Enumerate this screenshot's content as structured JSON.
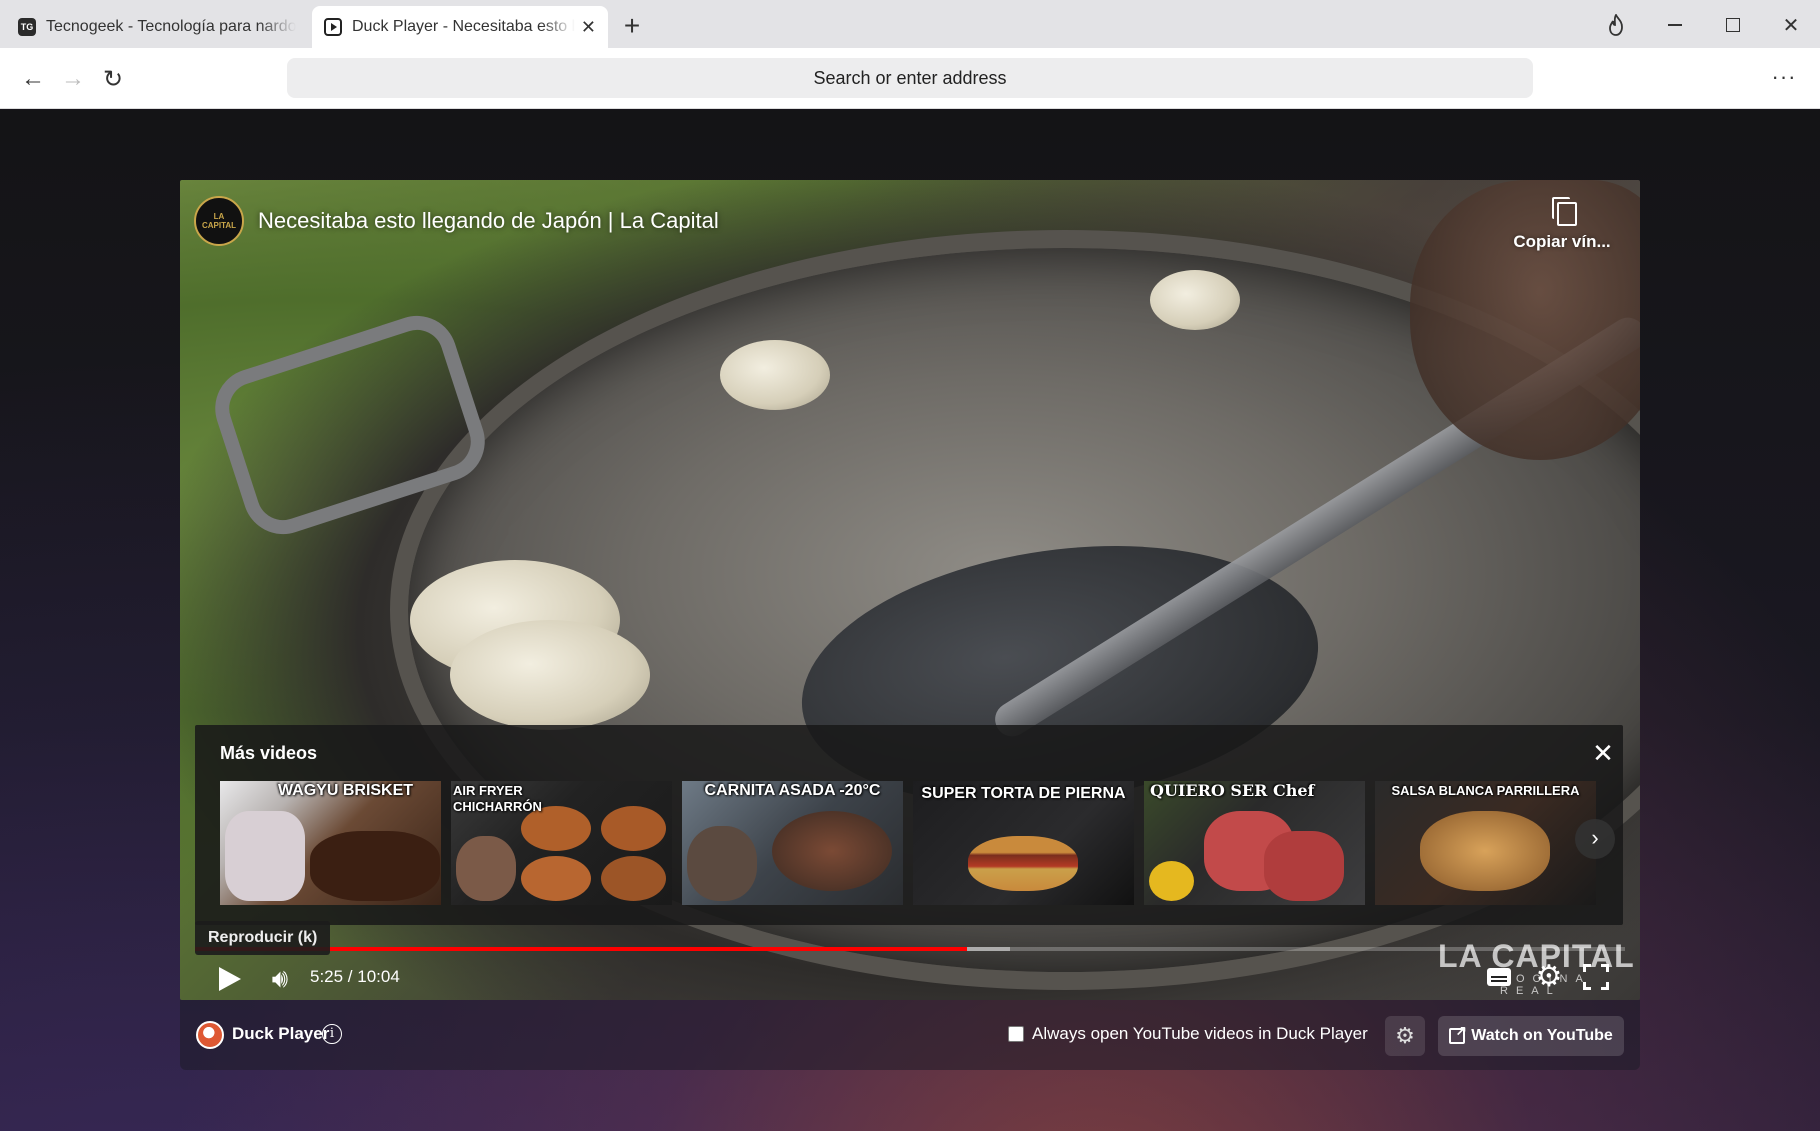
{
  "browser": {
    "tabs": [
      {
        "title": "Tecnogeek - Tecnología para nardogeeks",
        "favicon": "TG",
        "active": false
      },
      {
        "title": "Duck Player - Necesitaba esto llegando de Japón | La Capital",
        "favicon": "duck-player-icon",
        "active": true
      }
    ],
    "tab_close": "✕",
    "new_tab": "+",
    "address_placeholder": "Search or enter address",
    "menu": "···",
    "window_controls": {
      "close": "✕"
    }
  },
  "video": {
    "channel_avatar_text": "LA CAPITAL",
    "title": "Necesitaba esto llegando de Japón | La Capital",
    "copy_link_label": "Copiar vín...",
    "more_videos": {
      "title": "Más videos",
      "close": "✕",
      "next": "›",
      "items": [
        {
          "label": "WAGYU BRISKET"
        },
        {
          "label": "AIR FRYER CHICHARRÓN"
        },
        {
          "label": "CARNITA ASADA -20°C"
        },
        {
          "label": "SUPER TORTA DE PIERNA"
        },
        {
          "label": "QUIERO SER Chef"
        },
        {
          "label": "SALSA BLANCA PARRILLERA"
        }
      ]
    },
    "tooltip": "Reproducir (k)",
    "time": "5:25 / 10:04",
    "progress_played": 0.54,
    "progress_buffered": 0.57,
    "watermark": "LA CAPITAL",
    "watermark_sub": "COCINA REAL"
  },
  "duck_player": {
    "name": "Duck Player",
    "info_icon": "i",
    "always_open_label": "Always open YouTube videos in Duck Player",
    "always_open_checked": false,
    "watch_on_youtube": "Watch on YouTube"
  },
  "colors": {
    "progress_red": "#ff0000",
    "duck_orange": "#de5833"
  }
}
